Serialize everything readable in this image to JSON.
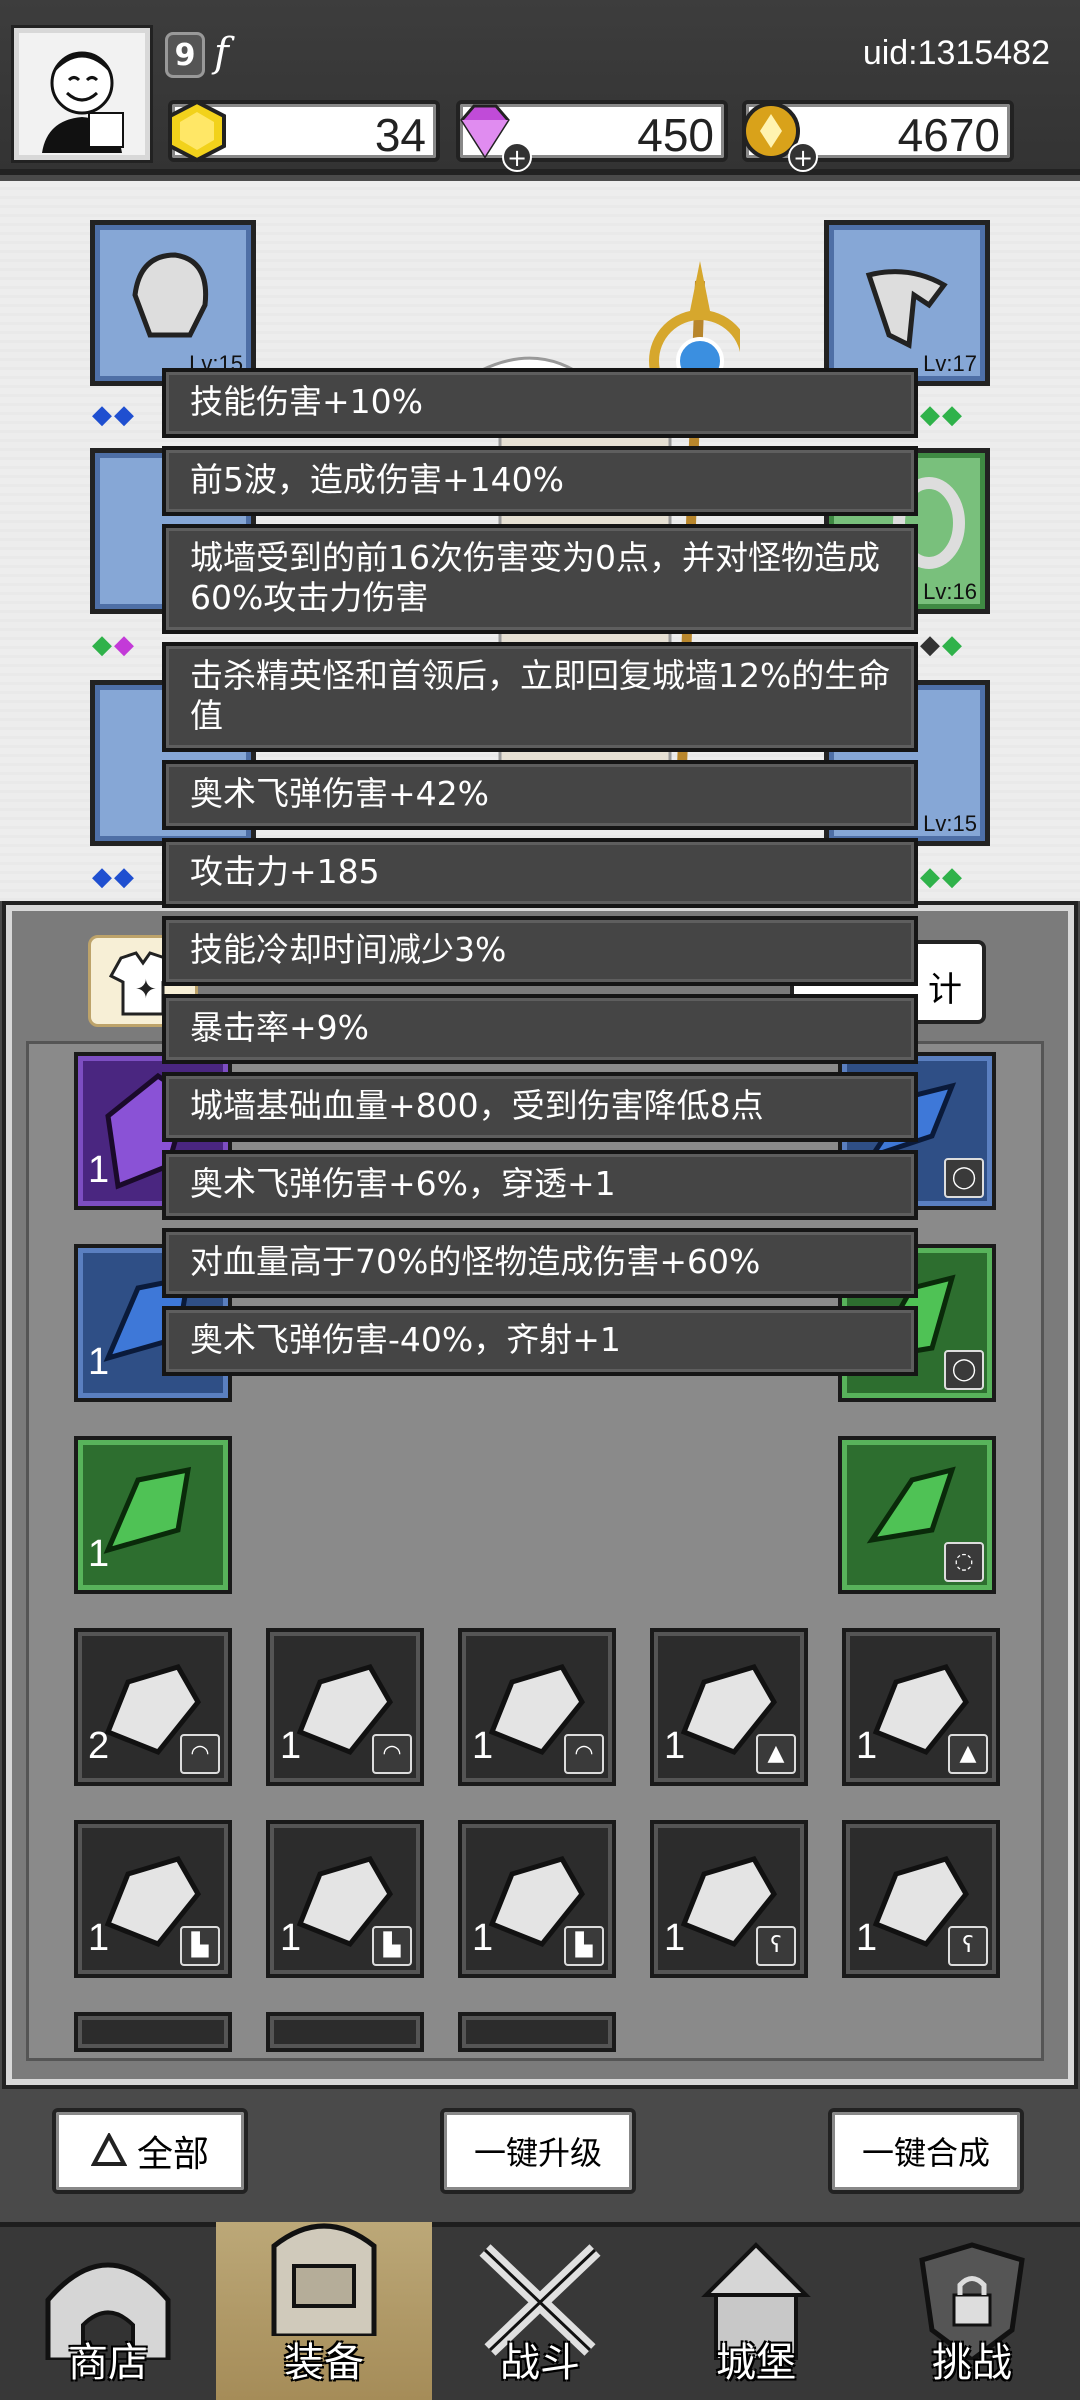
{
  "header": {
    "player_level": "9",
    "player_name": "f",
    "uid": "uid:1315482",
    "currencies": [
      {
        "name": "gold-gem",
        "value": "34",
        "color": "#f2d21b"
      },
      {
        "name": "diamond",
        "value": "450",
        "color": "#c04bd8"
      },
      {
        "name": "coin",
        "value": "4670",
        "color": "#d9a21a"
      }
    ]
  },
  "equipment": {
    "slots": [
      {
        "level": "Lv:15"
      },
      {
        "level": "Lv:17"
      },
      {
        "level": "Lv:16"
      },
      {
        "level": "Lv:15"
      }
    ]
  },
  "inventory": {
    "stats_button_label": "计",
    "counts": {
      "r1c1": "1",
      "r2c1": "1",
      "r3c1": "1",
      "r4": [
        "2",
        "1",
        "1",
        "1",
        "1"
      ],
      "r5": [
        "1",
        "1",
        "1",
        "1",
        "1"
      ]
    }
  },
  "tooltips": [
    "技能伤害+10%",
    "前5波，造成伤害+140%",
    "城墙受到的前16次伤害变为0点，并对怪物造成60%攻击力伤害",
    "击杀精英怪和首领后，立即回复城墙12%的生命值",
    "奥术飞弹伤害+42%",
    "攻击力+185",
    "技能冷却时间减少3%",
    "暴击率+9%",
    "城墙基础血量+800，受到伤害降低8点",
    "奥术飞弹伤害+6%，穿透+1",
    "对血量高于70%的怪物造成伤害+60%",
    "奥术飞弹伤害-40%，齐射+1"
  ],
  "actions": {
    "filter_all": "全部",
    "upgrade_all": "一键升级",
    "merge_all": "一键合成"
  },
  "nav": {
    "shop": "商店",
    "equipment": "装备",
    "battle": "战斗",
    "castle": "城堡",
    "challenge": "挑战"
  }
}
